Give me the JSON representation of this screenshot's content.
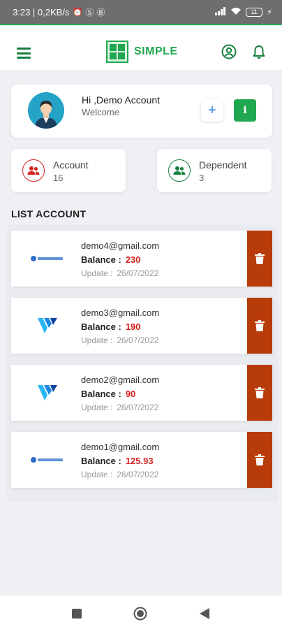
{
  "status_bar": {
    "time_info": "3:23 | 0,2KB/s",
    "battery": "11"
  },
  "app": {
    "title": "SIMPLE",
    "brand_color": "#1fa84f"
  },
  "profile": {
    "greeting": "Hi ,Demo Account",
    "subtitle": "Welcome",
    "add_label": "+",
    "info_label": "i"
  },
  "stats": {
    "account": {
      "label": "Account",
      "value": "16",
      "color": "#d62020"
    },
    "dependent": {
      "label": "Dependent",
      "value": "3",
      "color": "#16803e"
    }
  },
  "list": {
    "title": "LIST ACCOUNT",
    "balance_label": "Balance :",
    "update_label": "Update :",
    "items": [
      {
        "email": "demo4@gmail.com",
        "balance": "230",
        "updated": "26/07/2022",
        "logo": "vpsserver-logo"
      },
      {
        "email": "demo3@gmail.com",
        "balance": "190",
        "updated": "26/07/2022",
        "logo": "vultr-logo"
      },
      {
        "email": "demo2@gmail.com",
        "balance": "90",
        "updated": "26/07/2022",
        "logo": "vultr-logo"
      },
      {
        "email": "demo1@gmail.com",
        "balance": "125.93",
        "updated": "26/07/2022",
        "logo": "vpsserver-logo"
      }
    ],
    "delete_color": "#b83c0a"
  },
  "icons": {
    "menu": "hamburger-menu-icon",
    "user": "user-circle-icon",
    "notifications": "bell-icon",
    "delete": "trash-icon",
    "nav_recent": "square-icon",
    "nav_home": "circle-icon",
    "nav_back": "triangle-back-icon"
  }
}
